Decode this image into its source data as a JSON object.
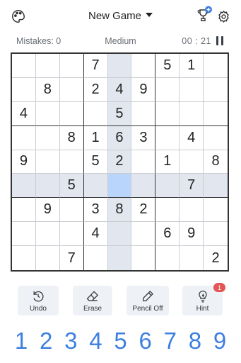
{
  "header": {
    "title": "New Game"
  },
  "status": {
    "mistakes": "Mistakes: 0",
    "difficulty": "Medium",
    "timer": "00 : 21"
  },
  "board": {
    "selected": [
      5,
      4
    ],
    "cells": [
      [
        "",
        "",
        "",
        "7",
        "",
        "",
        "5",
        "1",
        ""
      ],
      [
        "",
        "8",
        "",
        "2",
        "4",
        "9",
        "",
        "",
        ""
      ],
      [
        "4",
        "",
        "",
        "",
        "5",
        "",
        "",
        "",
        ""
      ],
      [
        "",
        "",
        "8",
        "1",
        "6",
        "3",
        "",
        "4",
        ""
      ],
      [
        "9",
        "",
        "",
        "5",
        "2",
        "",
        "1",
        "",
        "8"
      ],
      [
        "",
        "",
        "5",
        "",
        "",
        "",
        "",
        "7",
        ""
      ],
      [
        "",
        "9",
        "",
        "3",
        "8",
        "2",
        "",
        "",
        ""
      ],
      [
        "",
        "",
        "",
        "4",
        "",
        "",
        "6",
        "9",
        ""
      ],
      [
        "",
        "",
        "7",
        "",
        "",
        "",
        "",
        "",
        "2"
      ]
    ]
  },
  "tools": [
    {
      "name": "undo",
      "label": "Undo",
      "icon": "undo-icon"
    },
    {
      "name": "erase",
      "label": "Erase",
      "icon": "eraser-icon"
    },
    {
      "name": "pencil",
      "label": "Pencil Off",
      "icon": "pencil-icon"
    },
    {
      "name": "hint",
      "label": "Hint",
      "icon": "lightbulb-icon",
      "badge": "1"
    }
  ],
  "numpad": [
    "1",
    "2",
    "3",
    "4",
    "5",
    "6",
    "7",
    "8",
    "9"
  ],
  "colors": {
    "accent": "#3d7fe0",
    "highlight": "#e2e7ef",
    "selected": "#bad5fb",
    "badge": "#e25656"
  }
}
